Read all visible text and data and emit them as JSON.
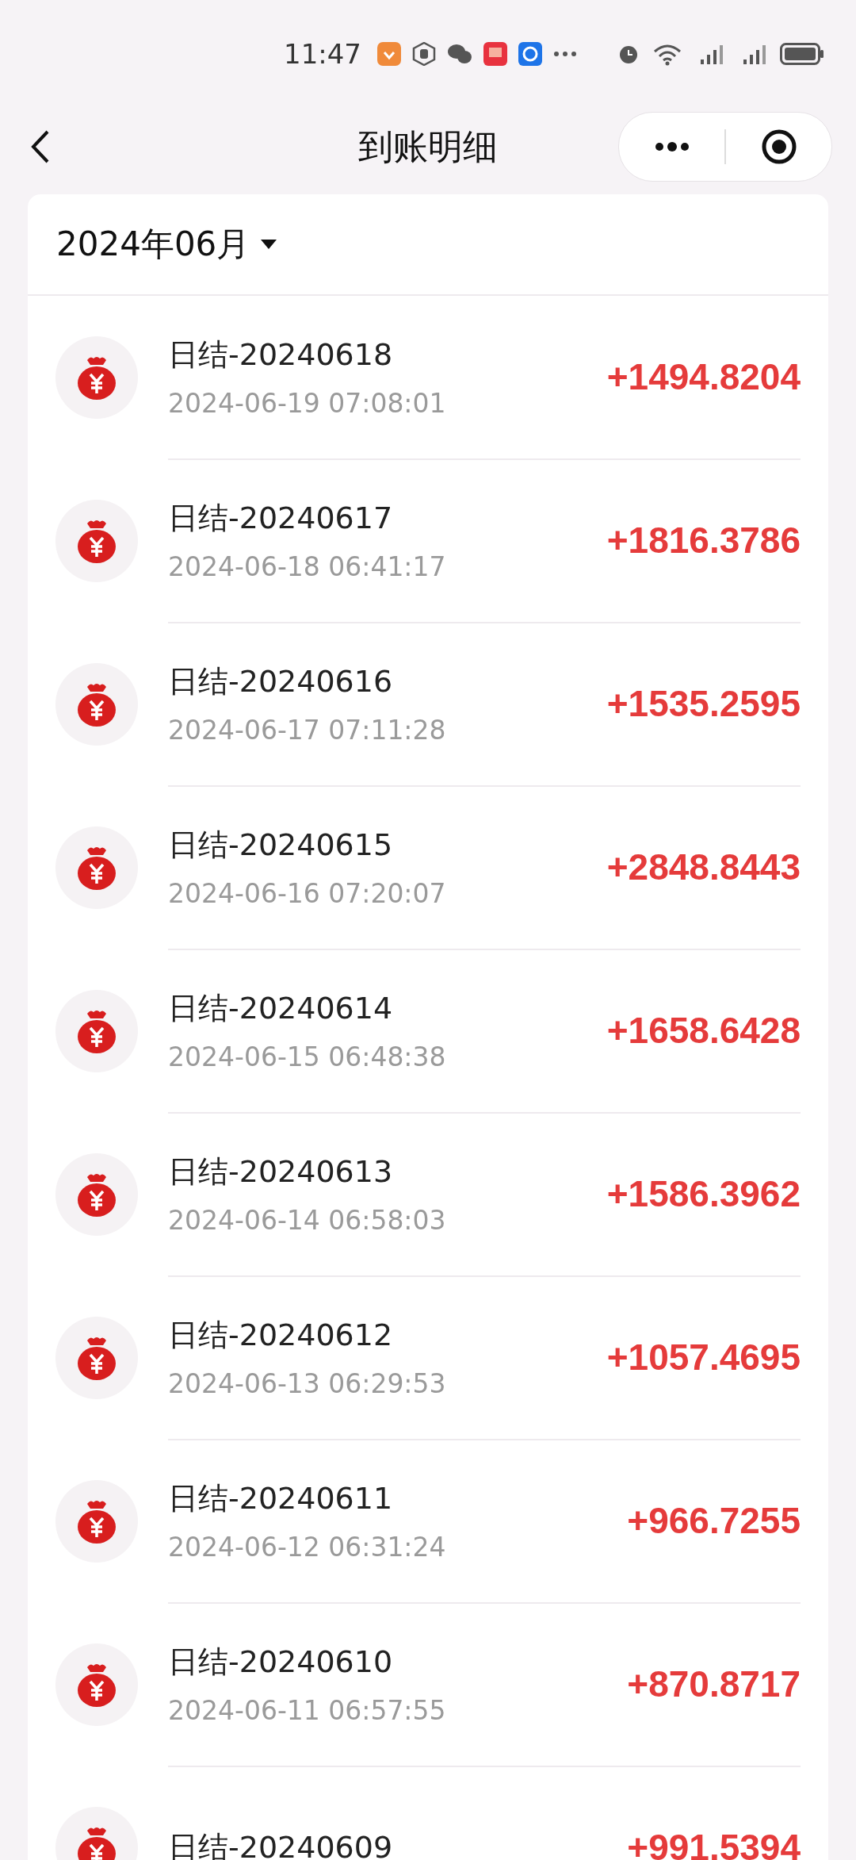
{
  "status_bar": {
    "time": "11:47"
  },
  "nav": {
    "title": "到账明细"
  },
  "month_picker": {
    "label": "2024年06月"
  },
  "entries": [
    {
      "title": "日结-20240618",
      "time": "2024-06-19 07:08:01",
      "amount": "+1494.8204"
    },
    {
      "title": "日结-20240617",
      "time": "2024-06-18 06:41:17",
      "amount": "+1816.3786"
    },
    {
      "title": "日结-20240616",
      "time": "2024-06-17 07:11:28",
      "amount": "+1535.2595"
    },
    {
      "title": "日结-20240615",
      "time": "2024-06-16 07:20:07",
      "amount": "+2848.8443"
    },
    {
      "title": "日结-20240614",
      "time": "2024-06-15 06:48:38",
      "amount": "+1658.6428"
    },
    {
      "title": "日结-20240613",
      "time": "2024-06-14 06:58:03",
      "amount": "+1586.3962"
    },
    {
      "title": "日结-20240612",
      "time": "2024-06-13 06:29:53",
      "amount": "+1057.4695"
    },
    {
      "title": "日结-20240611",
      "time": "2024-06-12 06:31:24",
      "amount": "+966.7255"
    },
    {
      "title": "日结-20240610",
      "time": "2024-06-11 06:57:55",
      "amount": "+870.8717"
    },
    {
      "title": "日结-20240609",
      "amount": "+991.5394"
    }
  ]
}
